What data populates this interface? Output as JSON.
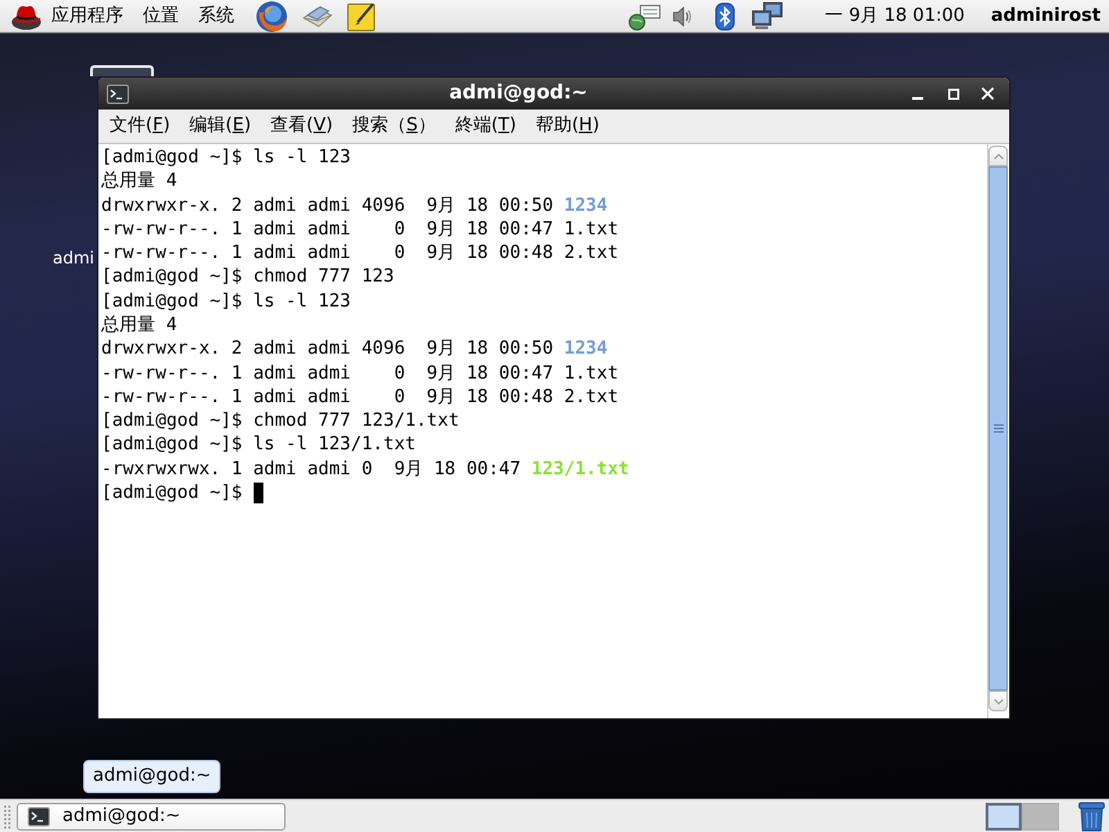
{
  "top_panel": {
    "menus": [
      "应用程序",
      "位置",
      "系统"
    ],
    "clock": "一 9月 18 01:00",
    "user": "adminirost"
  },
  "desktop": {
    "icon_label": "admi"
  },
  "window": {
    "title": "admi@god:~",
    "menu": [
      {
        "before": "文件(",
        "key": "F",
        "after": ")"
      },
      {
        "before": "编辑(",
        "key": "E",
        "after": ")"
      },
      {
        "before": "查看(",
        "key": "V",
        "after": ")"
      },
      {
        "before": "搜索（",
        "key": "S",
        "after": "）"
      },
      {
        "before": "終端(",
        "key": "T",
        "after": ")"
      },
      {
        "before": "帮助(",
        "key": "H",
        "after": ")"
      }
    ],
    "terminal": {
      "lines": [
        {
          "kind": "prompt",
          "prompt": "[admi@god ~]$",
          "command": "ls -l 123",
          "cursor": false
        },
        {
          "kind": "output",
          "text": "总用量 4"
        },
        {
          "kind": "listing",
          "details": "drwxrwxr-x. 2 admi admi 4096  9月 18 00:50",
          "file": {
            "name": "1234",
            "kind": "directory"
          }
        },
        {
          "kind": "listing",
          "details": "-rw-rw-r--. 1 admi admi    0  9月 18 00:47",
          "file": {
            "name": "1.txt",
            "kind": "regular"
          }
        },
        {
          "kind": "listing",
          "details": "-rw-rw-r--. 1 admi admi    0  9月 18 00:48",
          "file": {
            "name": "2.txt",
            "kind": "regular"
          }
        },
        {
          "kind": "prompt",
          "prompt": "[admi@god ~]$",
          "command": "chmod 777 123",
          "cursor": false
        },
        {
          "kind": "prompt",
          "prompt": "[admi@god ~]$",
          "command": "ls -l 123",
          "cursor": false
        },
        {
          "kind": "output",
          "text": "总用量 4"
        },
        {
          "kind": "listing",
          "details": "drwxrwxr-x. 2 admi admi 4096  9月 18 00:50",
          "file": {
            "name": "1234",
            "kind": "directory"
          }
        },
        {
          "kind": "listing",
          "details": "-rw-rw-r--. 1 admi admi    0  9月 18 00:47",
          "file": {
            "name": "1.txt",
            "kind": "regular"
          }
        },
        {
          "kind": "listing",
          "details": "-rw-rw-r--. 1 admi admi    0  9月 18 00:48",
          "file": {
            "name": "2.txt",
            "kind": "regular"
          }
        },
        {
          "kind": "prompt",
          "prompt": "[admi@god ~]$",
          "command": "chmod 777 123/1.txt",
          "cursor": false
        },
        {
          "kind": "prompt",
          "prompt": "[admi@god ~]$",
          "command": "ls -l 123/1.txt",
          "cursor": false
        },
        {
          "kind": "listing",
          "details": "-rwxrwxrwx. 1 admi admi 0  9月 18 00:47",
          "file": {
            "name": "123/1.txt",
            "kind": "executable"
          }
        },
        {
          "kind": "prompt",
          "prompt": "[admi@god ~]$",
          "cursor": true
        }
      ]
    }
  },
  "tooltip": "admi@god:~",
  "bottom_panel": {
    "tasks": [
      "admi@god:~"
    ],
    "workspaces": [
      {
        "selected": true
      },
      {
        "selected": false
      }
    ]
  }
}
